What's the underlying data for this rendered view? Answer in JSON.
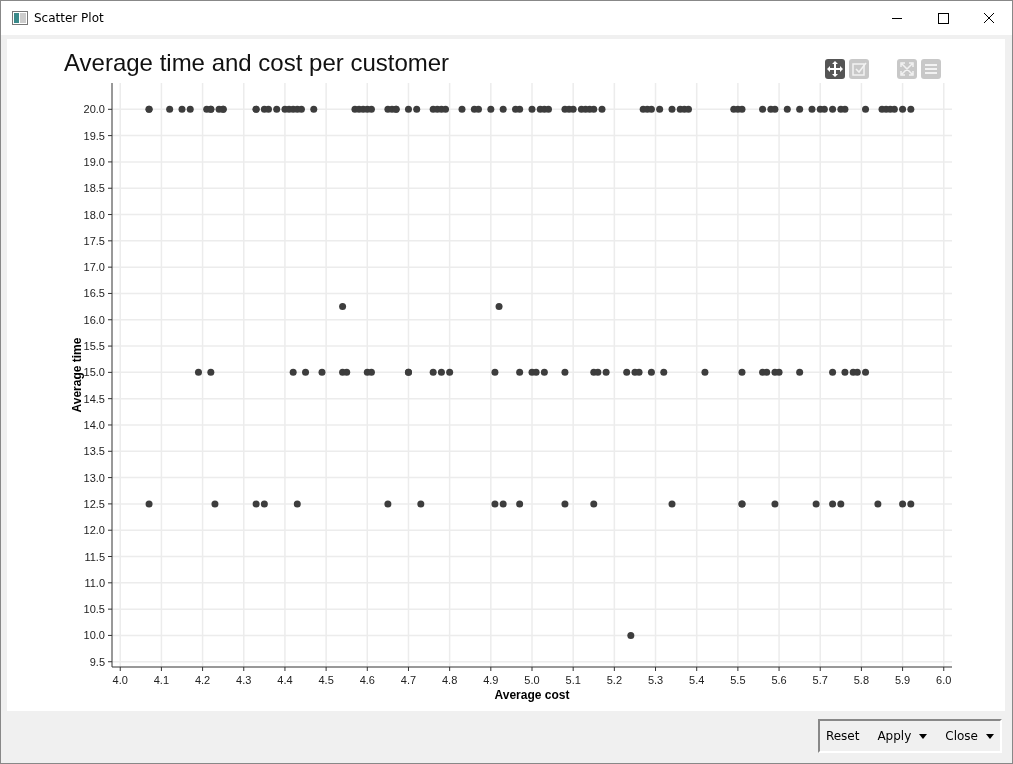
{
  "window": {
    "title": "Scatter Plot"
  },
  "toolbar": [
    {
      "kind": "pan",
      "selected": true
    },
    {
      "kind": "select",
      "selected": false
    },
    {
      "kind": "fit",
      "selected": false
    },
    {
      "kind": "menu",
      "selected": false
    }
  ],
  "chart": {
    "chart_data": {
      "type": "scatter",
      "title": "Average time and cost per customer",
      "xlabel": "Average cost",
      "ylabel": "Average time",
      "xlim": [
        3.98,
        6.02
      ],
      "ylim": [
        9.4,
        20.5
      ],
      "xticks": [
        {
          "value": 4.0,
          "label": "4.0"
        },
        {
          "value": 4.1,
          "label": "4.1"
        },
        {
          "value": 4.2,
          "label": "4.2"
        },
        {
          "value": 4.3,
          "label": "4.3"
        },
        {
          "value": 4.4,
          "label": "4.4"
        },
        {
          "value": 4.5,
          "label": "4.5"
        },
        {
          "value": 4.6,
          "label": "4.6"
        },
        {
          "value": 4.7,
          "label": "4.7"
        },
        {
          "value": 4.8,
          "label": "4.8"
        },
        {
          "value": 4.9,
          "label": "4.9"
        },
        {
          "value": 5.0,
          "label": "5.0"
        },
        {
          "value": 5.1,
          "label": "5.1"
        },
        {
          "value": 5.2,
          "label": "5.2"
        },
        {
          "value": 5.3,
          "label": "5.3"
        },
        {
          "value": 5.4,
          "label": "5.4"
        },
        {
          "value": 5.5,
          "label": "5.5"
        },
        {
          "value": 5.6,
          "label": "5.6"
        },
        {
          "value": 5.7,
          "label": "5.7"
        },
        {
          "value": 5.8,
          "label": "5.8"
        },
        {
          "value": 5.9,
          "label": "5.9"
        },
        {
          "value": 6.0,
          "label": "6.0"
        }
      ],
      "yticks": [
        {
          "value": 9.5,
          "label": "9.5"
        },
        {
          "value": 10,
          "label": "10.0"
        },
        {
          "value": 10.5,
          "label": "10.5"
        },
        {
          "value": 11,
          "label": "11.0"
        },
        {
          "value": 11.5,
          "label": "11.5"
        },
        {
          "value": 12,
          "label": "12.0"
        },
        {
          "value": 12.5,
          "label": "12.5"
        },
        {
          "value": 13,
          "label": "13.0"
        },
        {
          "value": 13.5,
          "label": "13.5"
        },
        {
          "value": 14,
          "label": "14.0"
        },
        {
          "value": 14.5,
          "label": "14.5"
        },
        {
          "value": 15,
          "label": "15.0"
        },
        {
          "value": 15.5,
          "label": "15.5"
        },
        {
          "value": 16,
          "label": "16.0"
        },
        {
          "value": 16.5,
          "label": "16.5"
        },
        {
          "value": 17,
          "label": "17.0"
        },
        {
          "value": 17.5,
          "label": "17.5"
        },
        {
          "value": 18,
          "label": "18.0"
        },
        {
          "value": 18.5,
          "label": "18.5"
        },
        {
          "value": 19,
          "label": "19.0"
        },
        {
          "value": 19.5,
          "label": "19.5"
        },
        {
          "value": 20,
          "label": "20.0"
        }
      ],
      "x": [
        4.07,
        4.07,
        4.12,
        4.15,
        4.17,
        4.21,
        4.22,
        4.22,
        4.24,
        4.25,
        4.25,
        4.33,
        4.33,
        4.35,
        4.36,
        4.38,
        4.4,
        4.41,
        4.42,
        4.43,
        4.44,
        4.47,
        4.57,
        4.58,
        4.59,
        4.6,
        4.61,
        4.65,
        4.66,
        4.67,
        4.67,
        4.7,
        4.72,
        4.76,
        4.77,
        4.78,
        4.79,
        4.83,
        4.86,
        4.87,
        4.9,
        4.93,
        4.96,
        4.97,
        5.0,
        5.02,
        5.03,
        5.04,
        5.08,
        5.09,
        5.1,
        5.12,
        5.13,
        5.14,
        5.15,
        5.17,
        5.27,
        5.28,
        5.29,
        5.31,
        5.34,
        5.36,
        5.37,
        5.38,
        5.49,
        5.5,
        5.51,
        5.56,
        5.58,
        5.59,
        5.62,
        5.65,
        5.68,
        5.7,
        5.71,
        5.73,
        5.75,
        5.76,
        5.81,
        5.85,
        5.86,
        5.87,
        5.88,
        5.9,
        5.92,
        4.54,
        4.92,
        4.19,
        4.22,
        4.42,
        4.45,
        4.49,
        4.54,
        4.55,
        4.6,
        4.61,
        4.7,
        4.7,
        4.76,
        4.78,
        4.8,
        4.91,
        4.97,
        5.0,
        5.01,
        5.03,
        5.08,
        5.15,
        5.16,
        5.18,
        5.23,
        5.25,
        5.26,
        5.29,
        5.32,
        5.42,
        5.51,
        5.56,
        5.57,
        5.59,
        5.6,
        5.65,
        5.73,
        5.76,
        5.78,
        5.79,
        5.81,
        4.07,
        4.23,
        4.33,
        4.35,
        4.43,
        4.65,
        4.73,
        4.91,
        4.93,
        4.97,
        5.08,
        5.15,
        5.34,
        5.51,
        5.51,
        5.59,
        5.69,
        5.73,
        5.75,
        5.84,
        5.9,
        5.92,
        5.24
      ],
      "grid": true,
      "series": [
        {
          "color": "#3d3d3d",
          "values": [
            20,
            20,
            20,
            20,
            20,
            20,
            20,
            20,
            20,
            20,
            20,
            20,
            20,
            20,
            20,
            20,
            20,
            20,
            20,
            20,
            20,
            20,
            20,
            20,
            20,
            20,
            20,
            20,
            20,
            20,
            20,
            20,
            20,
            20,
            20,
            20,
            20,
            20,
            20,
            20,
            20,
            20,
            20,
            20,
            20,
            20,
            20,
            20,
            20,
            20,
            20,
            20,
            20,
            20,
            20,
            20,
            20,
            20,
            20,
            20,
            20,
            20,
            20,
            20,
            20,
            20,
            20,
            20,
            20,
            20,
            20,
            20,
            20,
            20,
            20,
            20,
            20,
            20,
            20,
            20,
            20,
            20,
            20,
            20,
            20,
            16.25,
            16.25,
            15,
            15,
            15,
            15,
            15,
            15,
            15,
            15,
            15,
            15,
            15,
            15,
            15,
            15,
            15,
            15,
            15,
            15,
            15,
            15,
            15,
            15,
            15,
            15,
            15,
            15,
            15,
            15,
            15,
            15,
            15,
            15,
            15,
            15,
            15,
            15,
            15,
            15,
            15,
            15,
            12.5,
            12.5,
            12.5,
            12.5,
            12.5,
            12.5,
            12.5,
            12.5,
            12.5,
            12.5,
            12.5,
            12.5,
            12.5,
            12.5,
            12.5,
            12.5,
            12.5,
            12.5,
            12.5,
            12.5,
            12.5,
            12.5,
            10
          ]
        }
      ]
    }
  },
  "buttons": [
    {
      "label": "Reset",
      "dropdown": false
    },
    {
      "label": "Apply",
      "dropdown": true
    },
    {
      "label": "Close",
      "dropdown": true
    }
  ]
}
